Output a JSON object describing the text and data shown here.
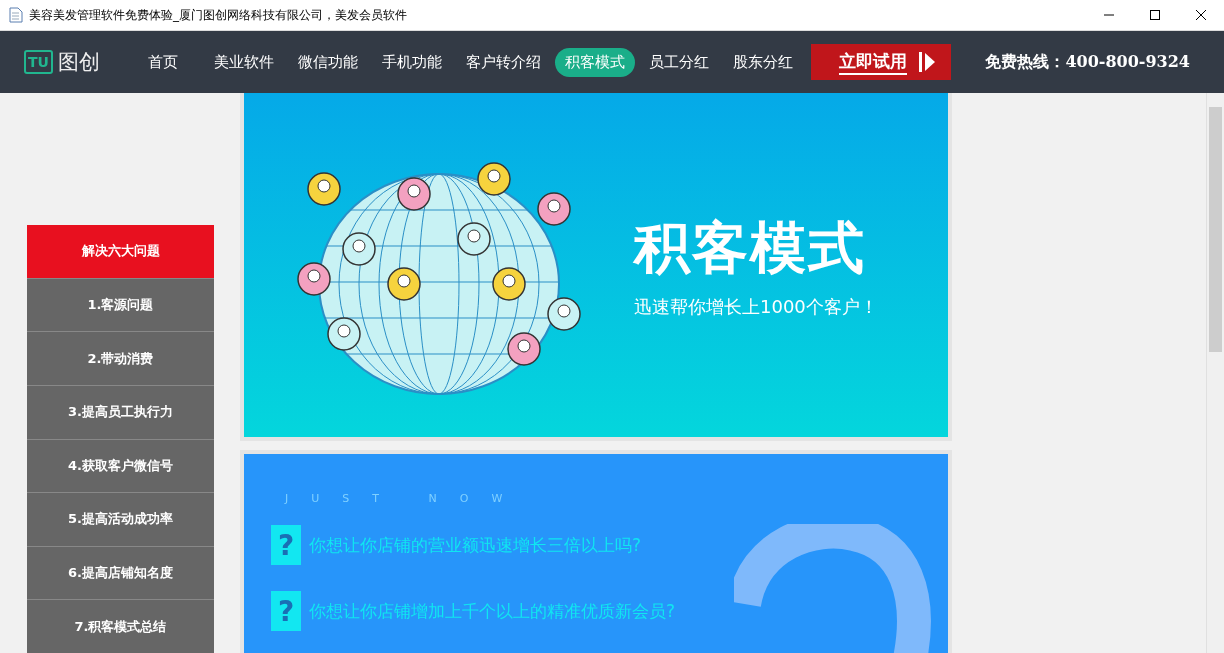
{
  "window": {
    "title": "美容美发管理软件免费体验_厦门图创网络科技有限公司，美发会员软件"
  },
  "nav": {
    "logo_mark": "TU",
    "logo_text": "图创",
    "items": [
      {
        "label": "首页",
        "selected": false
      },
      {
        "label": "美业软件",
        "selected": false
      },
      {
        "label": "微信功能",
        "selected": false
      },
      {
        "label": "手机功能",
        "selected": false
      },
      {
        "label": "客户转介绍",
        "selected": false
      },
      {
        "label": "积客模式",
        "selected": true
      },
      {
        "label": "员工分红",
        "selected": false
      },
      {
        "label": "股东分红",
        "selected": false
      }
    ],
    "trial_button": "立即试用",
    "hotline": "免费热线：400-800-9324"
  },
  "sidebar": {
    "title": "解决六大问题",
    "items": [
      "1.客源问题",
      "2.带动消费",
      "3.提高员工执行力",
      "4.获取客户微信号",
      "5.提高活动成功率",
      "6.提高店铺知名度",
      "7.积客模式总结"
    ]
  },
  "banner": {
    "title": "积客模式",
    "subtitle": "迅速帮你增长上1000个客户！"
  },
  "questions": {
    "eyebrow": "JUST NOW",
    "items": [
      {
        "icon": "?",
        "text": "你想让你店铺的营业额迅速增长三倍以上吗?"
      },
      {
        "icon": "?",
        "text": "你想让你店铺增加上千个以上的精准优质新会员?"
      }
    ]
  }
}
